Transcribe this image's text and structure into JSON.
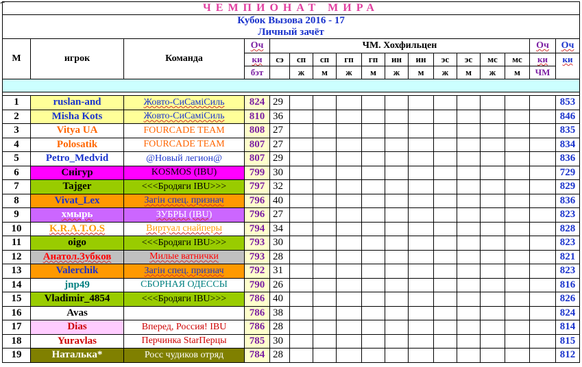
{
  "title": "ЧЕМПИОНАТ МИРА",
  "subtitle": "Кубок Вызова 2016 - 17",
  "subtitle2": "Личный зачёт",
  "headers": {
    "m": "М",
    "player": "игрок",
    "team": "Команда",
    "points_bet_1": "Оч",
    "points_bet_2": "ки",
    "points_bet_3": "бэт",
    "event_group": "ЧМ. Хохфильцен",
    "events": [
      {
        "a": "сэ",
        "b": ""
      },
      {
        "a": "сп",
        "b": "ж"
      },
      {
        "a": "сп",
        "b": "м"
      },
      {
        "a": "гп",
        "b": "ж"
      },
      {
        "a": "гп",
        "b": "м"
      },
      {
        "a": "ин",
        "b": "ж"
      },
      {
        "a": "ин",
        "b": "м"
      },
      {
        "a": "эс",
        "b": "ж"
      },
      {
        "a": "эс",
        "b": "м"
      },
      {
        "a": "мс",
        "b": "ж"
      },
      {
        "a": "мс",
        "b": "м"
      }
    ],
    "points_wc_1": "Оч",
    "points_wc_2": "ки",
    "points_wc_3": "ЧМ",
    "points_1": "Оч",
    "points_2": "ки"
  },
  "rows": [
    {
      "m": "1",
      "player": "ruslan-and",
      "team": "Жовто-СиСаміСиль",
      "bet": "824",
      "se": "29",
      "total": "853",
      "pbg": "#ffff99",
      "pfg": "#1a33cc",
      "tbg": "#ffff99",
      "tfg": "#1a33cc"
    },
    {
      "m": "2",
      "player": "Misha Kots",
      "team": "Жовто-СиСаміСиль",
      "bet": "810",
      "se": "36",
      "total": "846",
      "pbg": "#ffff99",
      "pfg": "#1a33cc",
      "tbg": "#ffff99",
      "tfg": "#1a33cc"
    },
    {
      "m": "3",
      "player": "Vitya UA",
      "team": "FOURCADE  TEAM",
      "bet": "808",
      "se": "27",
      "total": "835",
      "pbg": "#ffffff",
      "pfg": "#ff6600",
      "tbg": "#ffffff",
      "tfg": "#ff6600"
    },
    {
      "m": "4",
      "player": "Polosatik",
      "team": "FOURCADE  TEAM",
      "bet": "807",
      "se": "27",
      "total": "834",
      "pbg": "#ffffff",
      "pfg": "#ff6600",
      "tbg": "#ffffff",
      "tfg": "#ff6600"
    },
    {
      "m": "5",
      "player": "Petro_Medvid",
      "team": "@Новый легион@",
      "bet": "807",
      "se": "29",
      "total": "836",
      "pbg": "#ffffff",
      "pfg": "#1a33cc",
      "tbg": "#ffffff",
      "tfg": "#1a33cc"
    },
    {
      "m": "6",
      "player": "Снігур",
      "team": "KOSMOS (IBU)",
      "bet": "799",
      "se": "30",
      "total": "729",
      "pbg": "#ff00ff",
      "pfg": "#000000",
      "tbg": "#ff00ff",
      "tfg": "#000000"
    },
    {
      "m": "7",
      "player": "Tajger",
      "team": "<<<Бродяги IBU>>>",
      "bet": "797",
      "se": "32",
      "total": "829",
      "pbg": "#99cc00",
      "pfg": "#000000",
      "tbg": "#99cc00",
      "tfg": "#000000"
    },
    {
      "m": "8",
      "player": "Vivat_Lex",
      "team": "Загін спец. признач",
      "bet": "796",
      "se": "40",
      "total": "836",
      "pbg": "#ff9900",
      "pfg": "#1a33cc",
      "tbg": "#ff9900",
      "tfg": "#1a33cc"
    },
    {
      "m": "9",
      "player": "хмырь",
      "team": "ЗУБРЫ (IBU)",
      "bet": "796",
      "se": "27",
      "total": "823",
      "pbg": "#cc66ff",
      "pfg": "#ffffff",
      "tbg": "#cc66ff",
      "tfg": "#ffffff"
    },
    {
      "m": "10",
      "player": "K.R.A.T.O.S",
      "team": "Виртуал снайперы",
      "bet": "794",
      "se": "34",
      "total": "828",
      "pbg": "#ffffff",
      "pfg": "#ff9900",
      "tbg": "#ffffff",
      "tfg": "#ff9900"
    },
    {
      "m": "11",
      "player": "oigo",
      "team": "<<<Бродяги IBU>>>",
      "bet": "793",
      "se": "30",
      "total": "823",
      "pbg": "#99cc00",
      "pfg": "#000000",
      "tbg": "#99cc00",
      "tfg": "#000000"
    },
    {
      "m": "12",
      "player": "Анатол.Зубков",
      "team": "Милые ватнички",
      "bet": "793",
      "se": "28",
      "total": "821",
      "pbg": "#c0c0c0",
      "pfg": "#ff0000",
      "tbg": "#c0c0c0",
      "tfg": "#ff0000"
    },
    {
      "m": "13",
      "player": "Valerchik",
      "team": "Загін спец. признач",
      "bet": "792",
      "se": "31",
      "total": "823",
      "pbg": "#ff9900",
      "pfg": "#1a33cc",
      "tbg": "#ff9900",
      "tfg": "#1a33cc"
    },
    {
      "m": "14",
      "player": "jnp49",
      "team": "СБОРНАЯ ОДЕССЫ",
      "bet": "790",
      "se": "26",
      "total": "816",
      "pbg": "#ffffff",
      "pfg": "#008080",
      "tbg": "#ffffff",
      "tfg": "#008080"
    },
    {
      "m": "15",
      "player": "Vladimir_4854",
      "team": "<<<Бродяги IBU>>>",
      "bet": "786",
      "se": "40",
      "total": "826",
      "pbg": "#99cc00",
      "pfg": "#000000",
      "tbg": "#99cc00",
      "tfg": "#000000"
    },
    {
      "m": "16",
      "player": "Avas",
      "team": "",
      "bet": "786",
      "se": "38",
      "total": "824",
      "pbg": "#ffffff",
      "pfg": "#000000",
      "tbg": "#ffffff",
      "tfg": "#000000"
    },
    {
      "m": "17",
      "player": "Dias",
      "team": "Вперед, Россия! IBU",
      "bet": "786",
      "se": "28",
      "total": "814",
      "pbg": "#ffccff",
      "pfg": "#cc0000",
      "tbg": "#ffffff",
      "tfg": "#cc0000"
    },
    {
      "m": "18",
      "player": "Yuravlas",
      "team": "Перчинка StarПерцы",
      "bet": "785",
      "se": "30",
      "total": "815",
      "pbg": "#ffffff",
      "pfg": "#cc0000",
      "tbg": "#ffffff",
      "tfg": "#cc0000"
    },
    {
      "m": "19",
      "player": "Наталька*",
      "team": "Росс чудиков отряд",
      "bet": "784",
      "se": "28",
      "total": "812",
      "pbg": "#808000",
      "pfg": "#ffffff",
      "tbg": "#808000",
      "tfg": "#ffffff"
    }
  ]
}
